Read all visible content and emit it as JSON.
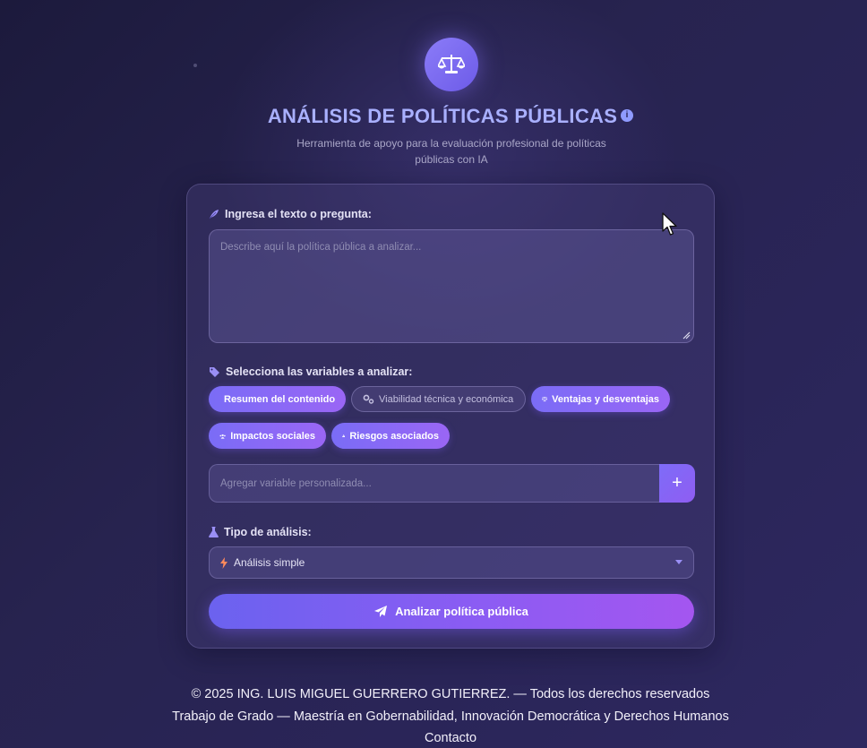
{
  "header": {
    "title": "ANÁLISIS DE POLÍTICAS PÚBLICAS",
    "subtitle": "Herramienta de apoyo para la evaluación profesional de políticas públicas con IA"
  },
  "form": {
    "text_label": "Ingresa el texto o pregunta:",
    "text_placeholder": "Describe aquí la política pública a analizar...",
    "variables_label": "Selecciona las variables a analizar:",
    "variables": [
      {
        "label": "Resumen del contenido",
        "selected": true,
        "icon": "file-icon"
      },
      {
        "label": "Viabilidad técnica y económica",
        "selected": false,
        "icon": "gears-icon"
      },
      {
        "label": "Ventajas y desventajas",
        "selected": true,
        "icon": "scale-icon"
      },
      {
        "label": "Impactos sociales",
        "selected": true,
        "icon": "users-icon"
      },
      {
        "label": "Riesgos asociados",
        "selected": true,
        "icon": "warning-icon"
      }
    ],
    "custom_variable_placeholder": "Agregar variable personalizada...",
    "add_button_label": "+",
    "analysis_type_label": "Tipo de análisis:",
    "analysis_type_value": "Análisis simple",
    "submit_label": "Analizar política pública"
  },
  "footer": {
    "copyright": "© 2025 ING. LUIS MIGUEL GUERRERO GUTIERREZ. — Todos los derechos reservados",
    "thesis": "Trabajo de Grado — Maestría en Gobernabilidad, Innovación Democrática y Derechos Humanos",
    "contact": "Contacto"
  },
  "colors": {
    "accent": "#7a6cf6",
    "title": "#a9b0ff",
    "background": "#27234f"
  }
}
